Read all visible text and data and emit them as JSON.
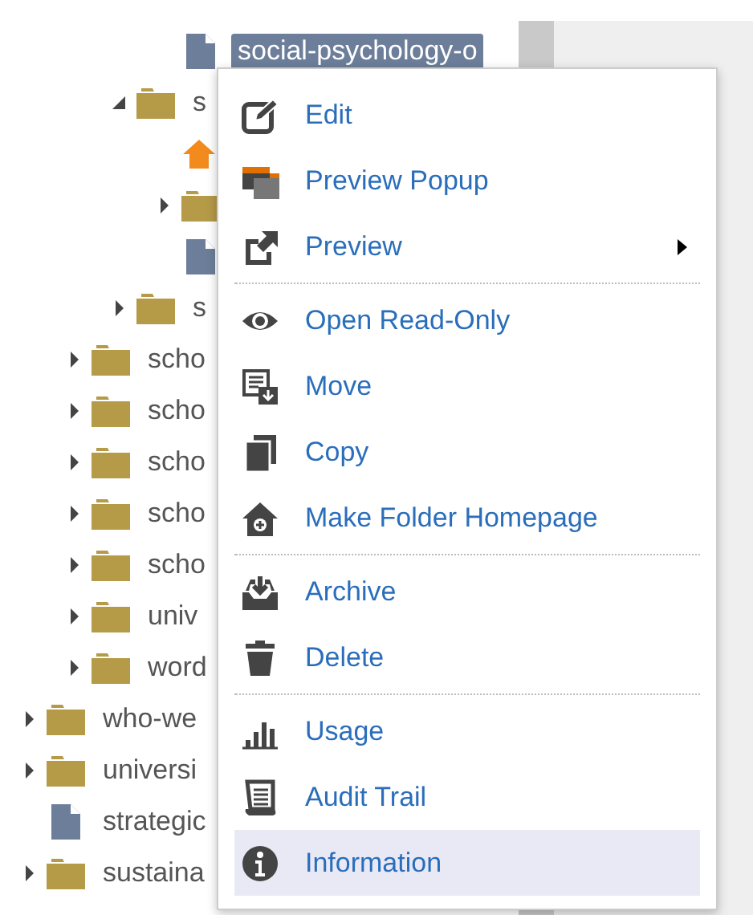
{
  "tree": [
    {
      "kind": "group",
      "children": [
        {
          "kind": "group",
          "children": [
            {
              "kind": "group",
              "children": [
                {
                  "kind": "file",
                  "label": "social-psychology-o",
                  "selected": true
                }
              ]
            },
            {
              "kind": "folder",
              "label": "s",
              "expanded": true,
              "children": [
                {
                  "kind": "home"
                },
                {
                  "kind": "folder",
                  "expanded": false
                },
                {
                  "kind": "file",
                  "selected": false
                }
              ]
            },
            {
              "kind": "folder",
              "label": "s",
              "expanded": false
            }
          ]
        },
        {
          "kind": "folder",
          "label": "scho",
          "expanded": false
        },
        {
          "kind": "folder",
          "label": "scho",
          "expanded": false
        },
        {
          "kind": "folder",
          "label": "scho",
          "expanded": false
        },
        {
          "kind": "folder",
          "label": "scho",
          "expanded": false
        },
        {
          "kind": "folder",
          "label": "scho",
          "expanded": false
        },
        {
          "kind": "folder",
          "label": "univ",
          "expanded": false
        },
        {
          "kind": "folder",
          "label": "word",
          "expanded": false
        }
      ]
    },
    {
      "kind": "folder",
      "label": "who-we",
      "expanded": false
    },
    {
      "kind": "folder",
      "label": "universi",
      "expanded": false
    },
    {
      "kind": "file",
      "label": "strategic",
      "selected": false
    },
    {
      "kind": "folder",
      "label": "sustaina",
      "expanded": false
    }
  ],
  "context_menu": [
    {
      "kind": "edit",
      "label": "Edit",
      "selected": false
    },
    {
      "kind": "popup",
      "label": "Preview Popup",
      "selected": false
    },
    {
      "kind": "preview",
      "label": "Preview",
      "submenu": true,
      "selected": false
    },
    {
      "kind": "separator"
    },
    {
      "kind": "eye",
      "label": "Open Read-Only",
      "selected": false
    },
    {
      "kind": "move",
      "label": "Move",
      "selected": false
    },
    {
      "kind": "copy",
      "label": "Copy",
      "selected": false
    },
    {
      "kind": "home",
      "label": "Make Folder Homepage",
      "selected": false
    },
    {
      "kind": "separator"
    },
    {
      "kind": "archive",
      "label": "Archive",
      "selected": false
    },
    {
      "kind": "delete",
      "label": "Delete",
      "selected": false
    },
    {
      "kind": "separator"
    },
    {
      "kind": "usage",
      "label": "Usage",
      "selected": false
    },
    {
      "kind": "audit",
      "label": "Audit Trail",
      "selected": false
    },
    {
      "kind": "info",
      "label": "Information",
      "selected": true
    }
  ]
}
